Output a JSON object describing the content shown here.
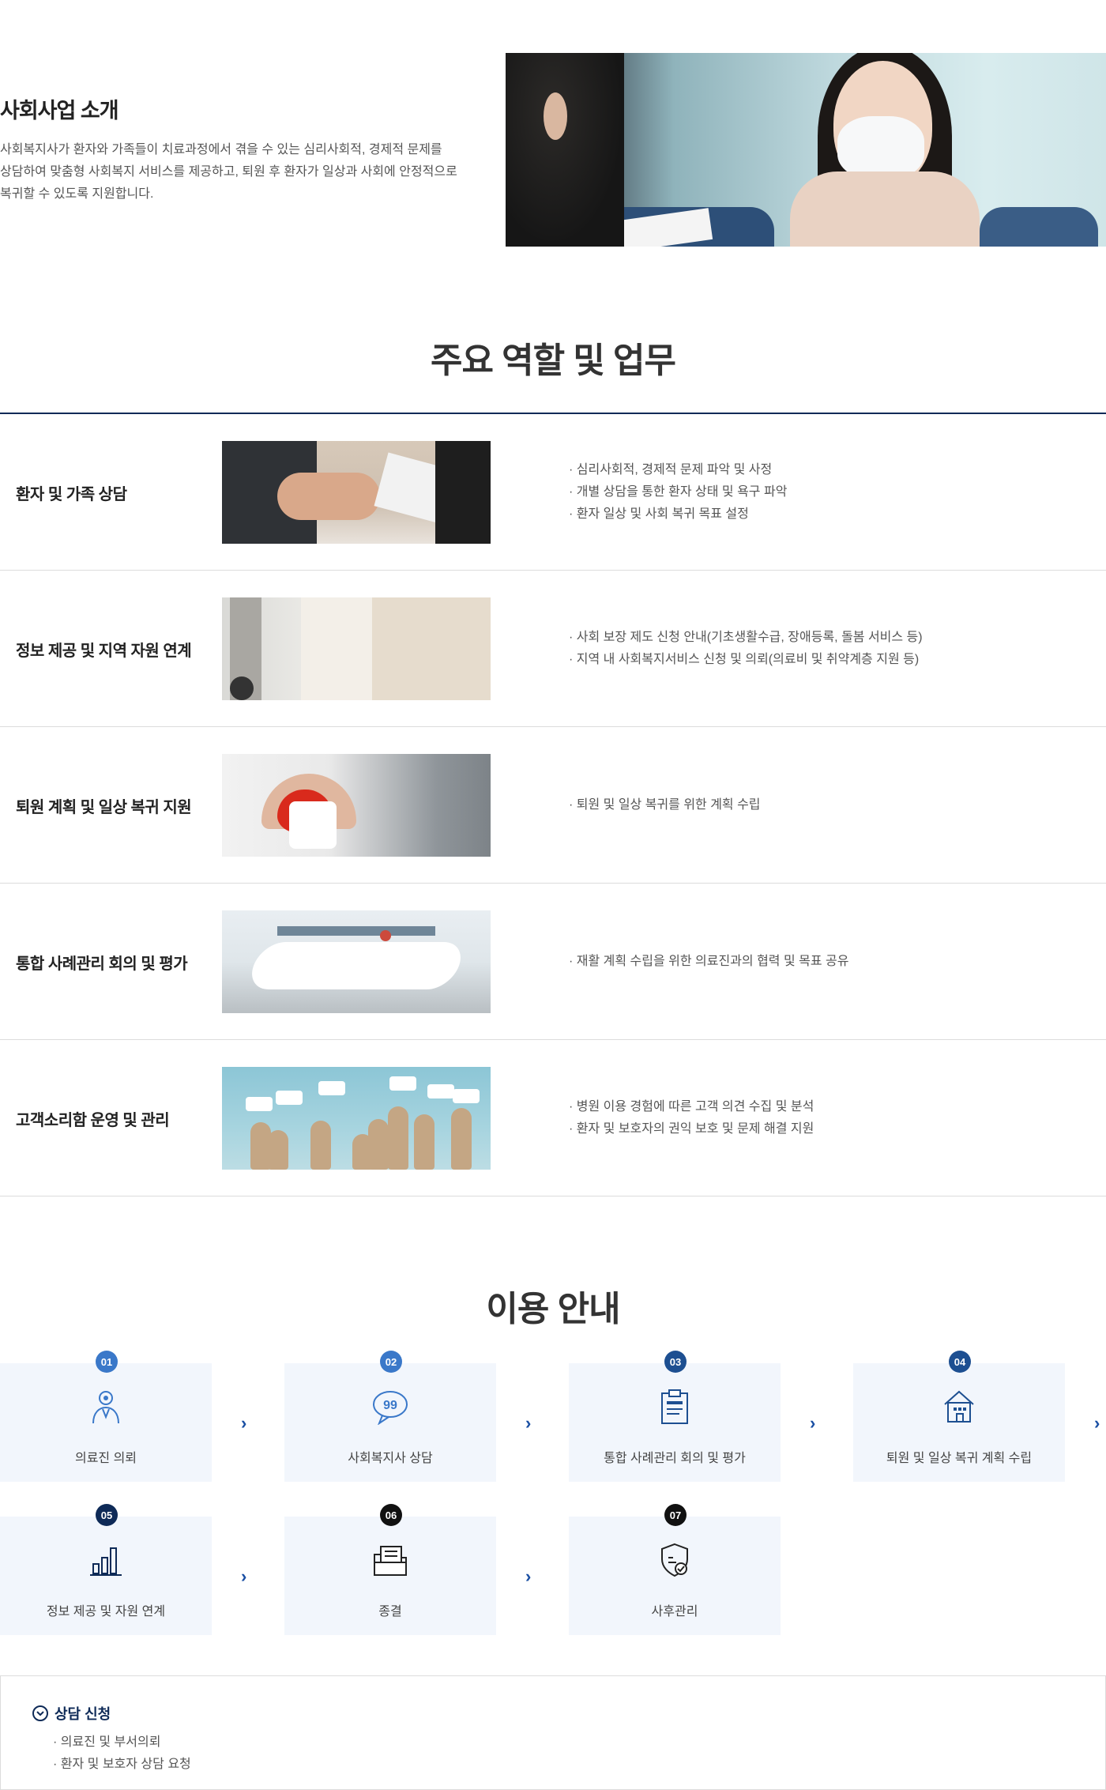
{
  "intro": {
    "title": "사회사업 소개",
    "description_lines": [
      "사회복지사가 환자와 가족들이 치료과정에서 겪을 수 있는 심리사회적, 경제적 문제를",
      "상담하여 맞춤형 사회복지 서비스를 제공하고, 퇴원 후 환자가 일상과 사회에 안정적으로",
      "복귀할 수 있도록 지원합니다."
    ]
  },
  "roles": {
    "heading": "주요 역할 및 업무",
    "items": [
      {
        "title": "환자 및 가족 상담",
        "bullets": [
          "· 심리사회적, 경제적 문제 파악 및 사정",
          "· 개별 상담을 통한 환자 상태 및 욕구 파악",
          "· 환자 일상 및 사회 복귀 목표 설정"
        ]
      },
      {
        "title": "정보 제공 및 지역 자원 연계",
        "bullets": [
          "· 사회 보장 제도 신청 안내(기초생활수급, 장애등록, 돌봄 서비스 등)",
          "· 지역 내 사회복지서비스 신청 및 의뢰(의료비 및 취약계층 지원 등)"
        ]
      },
      {
        "title": "퇴원 계획 및 일상 복귀 지원",
        "bullets": [
          "· 퇴원 및 일상 복귀를 위한 계획 수립"
        ]
      },
      {
        "title": "통합 사례관리 회의 및 평가",
        "bullets": [
          "· 재활 계획 수립을 위한 의료진과의 협력 및 목표 공유"
        ]
      },
      {
        "title": "고객소리함 운영 및 관리",
        "bullets": [
          "· 병원 이용 경험에 따른 고객 의견 수집 및 분석",
          "· 환자 및 보호자의 권익 보호 및 문제 해결 지원"
        ]
      }
    ]
  },
  "usage": {
    "heading": "이용 안내",
    "steps": [
      {
        "num": "01",
        "label": "의료진 의뢰",
        "icon": "doctor-icon"
      },
      {
        "num": "02",
        "label": "사회복지사 상담",
        "icon": "speech-bubble-icon"
      },
      {
        "num": "03",
        "label": "통합 사례관리 회의 및 평가",
        "icon": "clipboard-icon"
      },
      {
        "num": "04",
        "label": "퇴원 및 일상 복귀 계획 수립",
        "icon": "house-icon"
      },
      {
        "num": "05",
        "label": "정보 제공 및 자원 연계",
        "icon": "bar-chart-icon"
      },
      {
        "num": "06",
        "label": "종결",
        "icon": "folder-icon"
      },
      {
        "num": "07",
        "label": "사후관리",
        "icon": "shield-check-icon"
      }
    ],
    "colors": {
      "step_bg": "#f2f6fc",
      "badge_light": "#3a78c9",
      "badge_mid": "#1d4f91",
      "badge_dark": "#0e2a57",
      "badge_black": "#111111",
      "arrow": "#1a4fa3"
    }
  },
  "consult": {
    "title": "상담 신청",
    "items": [
      "· 의료진 및 부서의뢰",
      "· 환자 및 보호자 상담 요청"
    ]
  }
}
